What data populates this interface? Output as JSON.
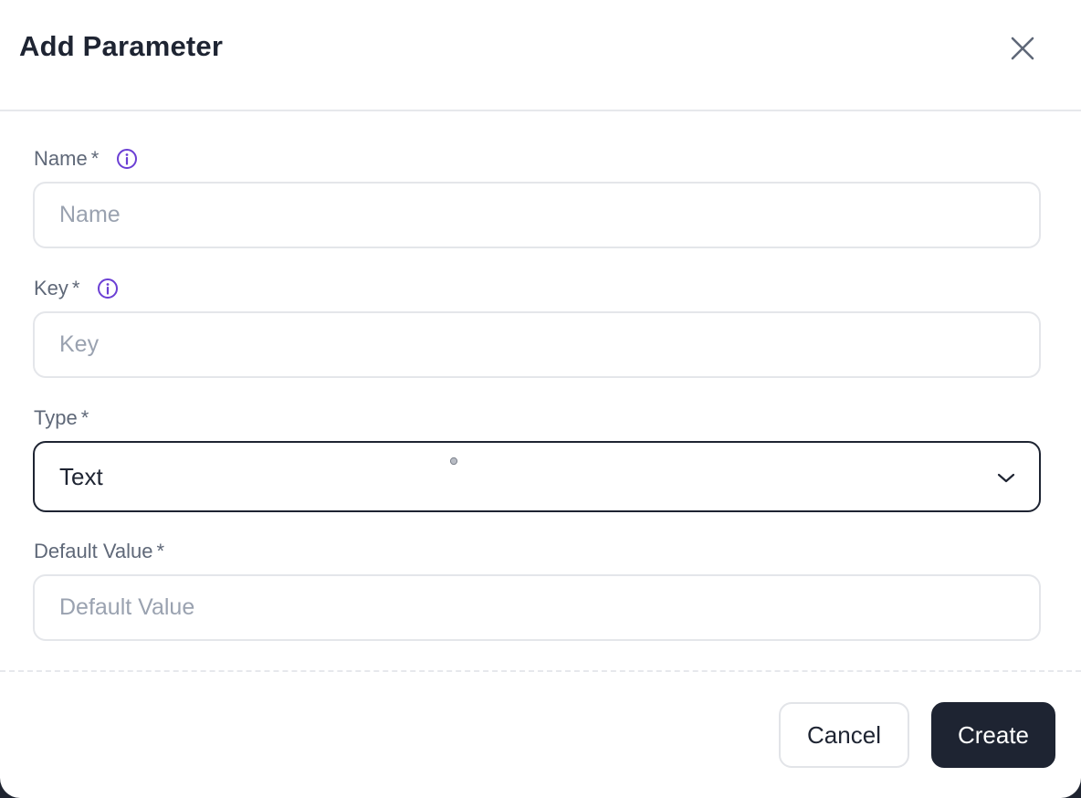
{
  "dialog": {
    "title": "Add Parameter"
  },
  "fields": {
    "name": {
      "label": "Name",
      "required_mark": "*",
      "placeholder": "Name",
      "value": ""
    },
    "key": {
      "label": "Key",
      "required_mark": "*",
      "placeholder": "Key",
      "value": ""
    },
    "type": {
      "label": "Type",
      "required_mark": "*",
      "selected": "Text"
    },
    "default_value": {
      "label": "Default Value",
      "required_mark": "*",
      "placeholder": "Default Value",
      "value": ""
    }
  },
  "footer": {
    "cancel_label": "Cancel",
    "create_label": "Create"
  },
  "icons": {
    "close": "close-icon",
    "info": "info-icon",
    "chevron": "chevron-down-icon"
  },
  "colors": {
    "primary": "#1e2432",
    "info_accent": "#6b3fd4",
    "label": "#5f6878",
    "placeholder": "#9aa2b0",
    "border": "#e4e6ea"
  }
}
